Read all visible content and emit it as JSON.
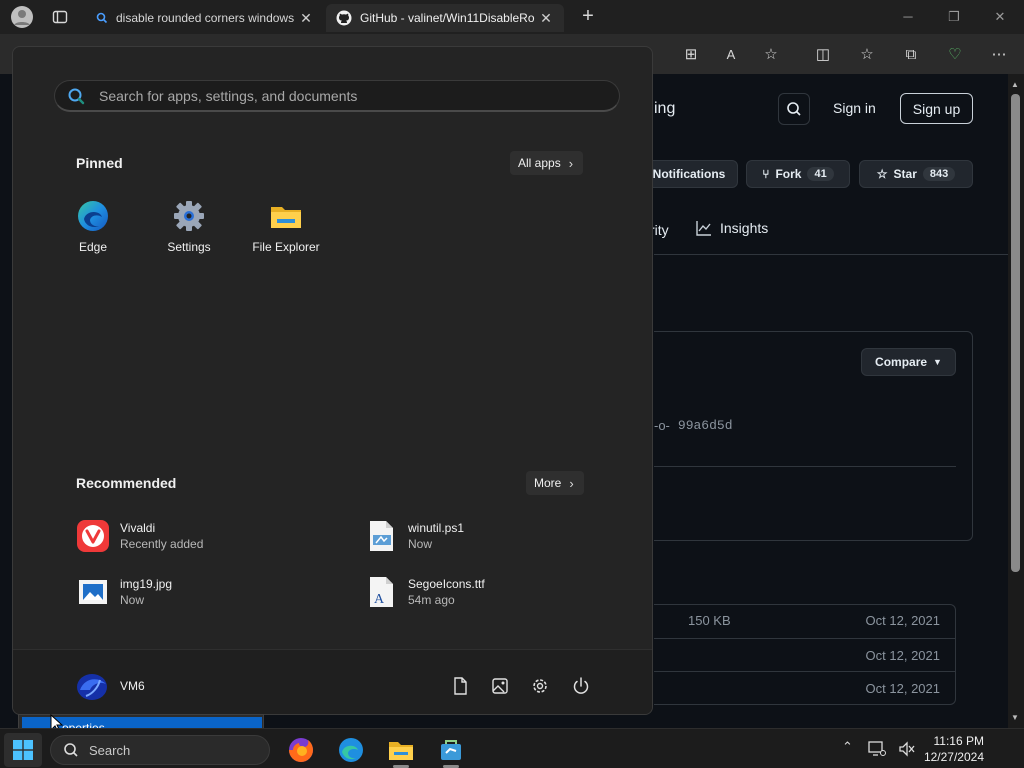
{
  "browser": {
    "tabs": [
      {
        "label": "disable rounded corners windows",
        "icon": "search-icon"
      },
      {
        "label": "GitHub - valinet/Win11DisableRo",
        "icon": "github-icon"
      }
    ],
    "new_tab_label": "+"
  },
  "github": {
    "header_fragment": "ing",
    "sign_in": "Sign in",
    "sign_up": "Sign up",
    "notifications": "Notifications",
    "fork_label": "Fork",
    "fork_count": "41",
    "star_label": "Star",
    "star_count": "843",
    "nav_fragment": "rity",
    "insights": "Insights",
    "compare": "Compare",
    "commit": "99a6d5d",
    "files": [
      {
        "size": "150 KB",
        "date": "Oct 12, 2021"
      },
      {
        "size": "",
        "date": "Oct 12, 2021"
      },
      {
        "size": "",
        "date": "Oct 12, 2021"
      }
    ]
  },
  "start_menu": {
    "search_placeholder": "Search for apps, settings, and documents",
    "pinned_title": "Pinned",
    "all_apps": "All apps",
    "pinned": [
      {
        "label": "Edge",
        "icon": "edge-icon"
      },
      {
        "label": "Settings",
        "icon": "settings-gear-icon"
      },
      {
        "label": "File Explorer",
        "icon": "folder-icon"
      }
    ],
    "recommended_title": "Recommended",
    "more": "More",
    "recommended": [
      {
        "name": "Vivaldi",
        "sub": "Recently added",
        "icon": "vivaldi-icon"
      },
      {
        "name": "winutil.ps1",
        "sub": "Now",
        "icon": "script-file-icon"
      },
      {
        "name": "img19.jpg",
        "sub": "Now",
        "icon": "image-file-icon"
      },
      {
        "name": "SegoeIcons.ttf",
        "sub": "54m ago",
        "icon": "font-file-icon"
      }
    ],
    "user": "VM6"
  },
  "context_menu": {
    "item": "Properties",
    "visible_text": "operties"
  },
  "taskbar": {
    "search": "Search",
    "time": "11:16 PM",
    "date": "12/27/2024"
  },
  "colors": {
    "accent": "#0a64c8",
    "start_bg": "#242424",
    "github_bg": "#0d1117"
  }
}
